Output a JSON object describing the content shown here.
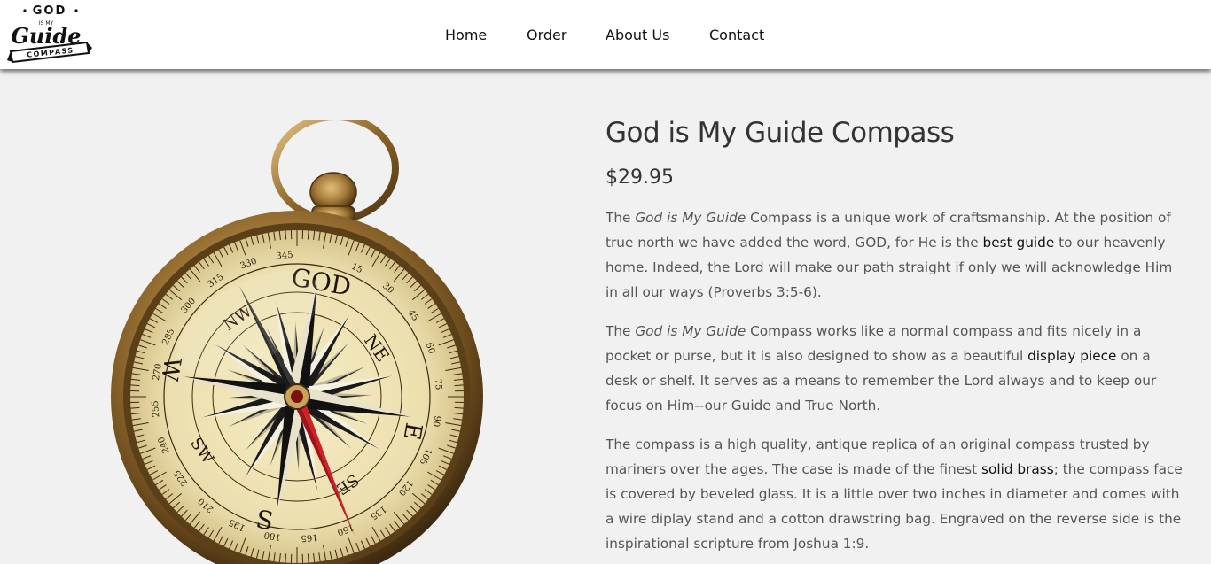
{
  "logo": {
    "line1": "GOD",
    "line2": "IS MY",
    "line3": "Guide",
    "line4": "COMPASS"
  },
  "nav": {
    "home": "Home",
    "order": "Order",
    "about": "About Us",
    "contact": "Contact"
  },
  "product": {
    "title": "God is My Guide Compass",
    "price": "$29.95",
    "p1": {
      "t1": "The ",
      "em1": "God is My Guide",
      "t2": " Compass is a unique work of craftsmanship. At the position of true north we have added the word, GOD, for He is the ",
      "b1": "best guide",
      "t3": " to our heavenly home. Indeed, the Lord will make our path straight if only we will acknowledge Him in all our ways (Proverbs 3:5-6)."
    },
    "p2": {
      "t1": "The ",
      "em1": "God is My Guide",
      "t2": " Compass works like a normal compass and fits nicely in a pocket or purse, but it is also designed to show as a beautiful ",
      "b1": "display piece",
      "t3": " on a desk or shelf. It serves as a means to remember the Lord always and to keep our focus on Him--our Guide and True North."
    },
    "p3": {
      "t1": "The compass is a high quality, antique replica of an original compass trusted by mariners over the ages. The case is made of the finest ",
      "b1": "solid brass",
      "t2": "; the compass face is covered by beveled glass. It is a little over two inches in diameter and comes with a wire diplay stand and a cotton drawstring bag. Engraved on the reverse side is the inspirational scripture from Joshua 1:9."
    }
  },
  "compass": {
    "god_label": "GOD",
    "ne": "NE",
    "e": "E",
    "se": "SE",
    "s": "S",
    "sw": "SW",
    "w": "W",
    "nw": "NW",
    "deg_labels": [
      "330",
      "345",
      "15",
      "30",
      "45",
      "315",
      "300",
      "285",
      "270",
      "255",
      "240",
      "225",
      "210",
      "195",
      "180",
      "165",
      "150",
      "135",
      "120",
      "105",
      "90",
      "75",
      "60"
    ]
  },
  "colors": {
    "background": "#f1f1f1",
    "brass": "#a67c3a",
    "dial": "#efe4b8",
    "needle_red": "#b8141a"
  }
}
